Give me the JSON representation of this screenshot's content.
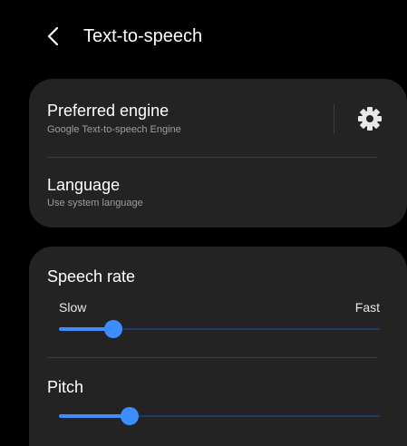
{
  "header": {
    "back_icon": "chevron-left-icon",
    "title": "Text-to-speech"
  },
  "engine_card": {
    "preferred_engine": {
      "title": "Preferred engine",
      "subtitle": "Google Text-to-speech Engine",
      "settings_icon": "gear-icon"
    },
    "language": {
      "title": "Language",
      "subtitle": "Use system language"
    }
  },
  "speech_card": {
    "speech_rate": {
      "title": "Speech rate",
      "min_label": "Slow",
      "max_label": "Fast",
      "value_fraction": 0.17
    },
    "pitch": {
      "title": "Pitch",
      "value_fraction": 0.22
    }
  },
  "colors": {
    "background": "#000000",
    "card": "#232323",
    "accent": "#3d8dff",
    "track": "#1f3c64",
    "secondary_text": "#9e9e9e"
  }
}
